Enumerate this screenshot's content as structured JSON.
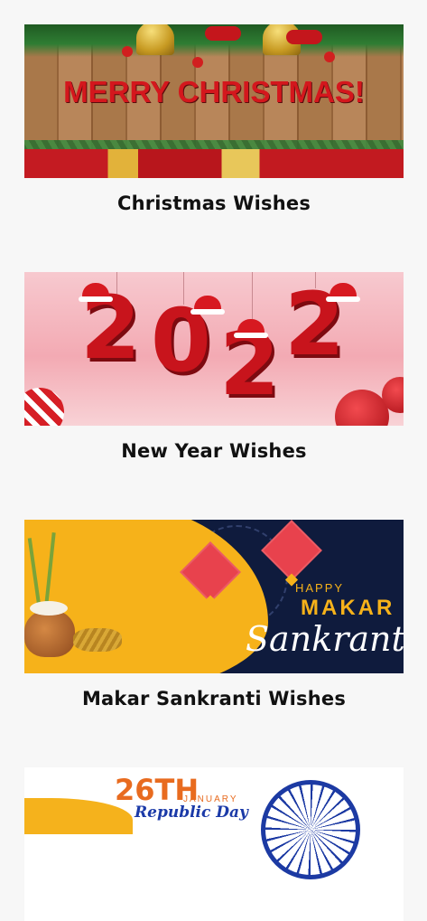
{
  "cards": [
    {
      "caption": "Christmas Wishes",
      "banner_text": "MERRY CHRISTMAS!"
    },
    {
      "caption": "New Year Wishes",
      "banner_text": "2022"
    },
    {
      "caption": "Makar Sankranti Wishes",
      "banner_lines": [
        "HAPPY",
        "MAKAR",
        "Sankranti"
      ]
    },
    {
      "caption": "",
      "banner_lines": [
        "26TH",
        "JANUARY",
        "Republic Day"
      ]
    }
  ],
  "colors": {
    "background": "#f7f7f7",
    "caption_text": "#111111",
    "christmas_red": "#d4171d",
    "newyear_red": "#c8141c",
    "sankranti_navy": "#0f1b3d",
    "sankranti_yellow": "#f6b21a",
    "republic_saffron": "#e86b1f",
    "republic_blue": "#1c3aa3"
  }
}
